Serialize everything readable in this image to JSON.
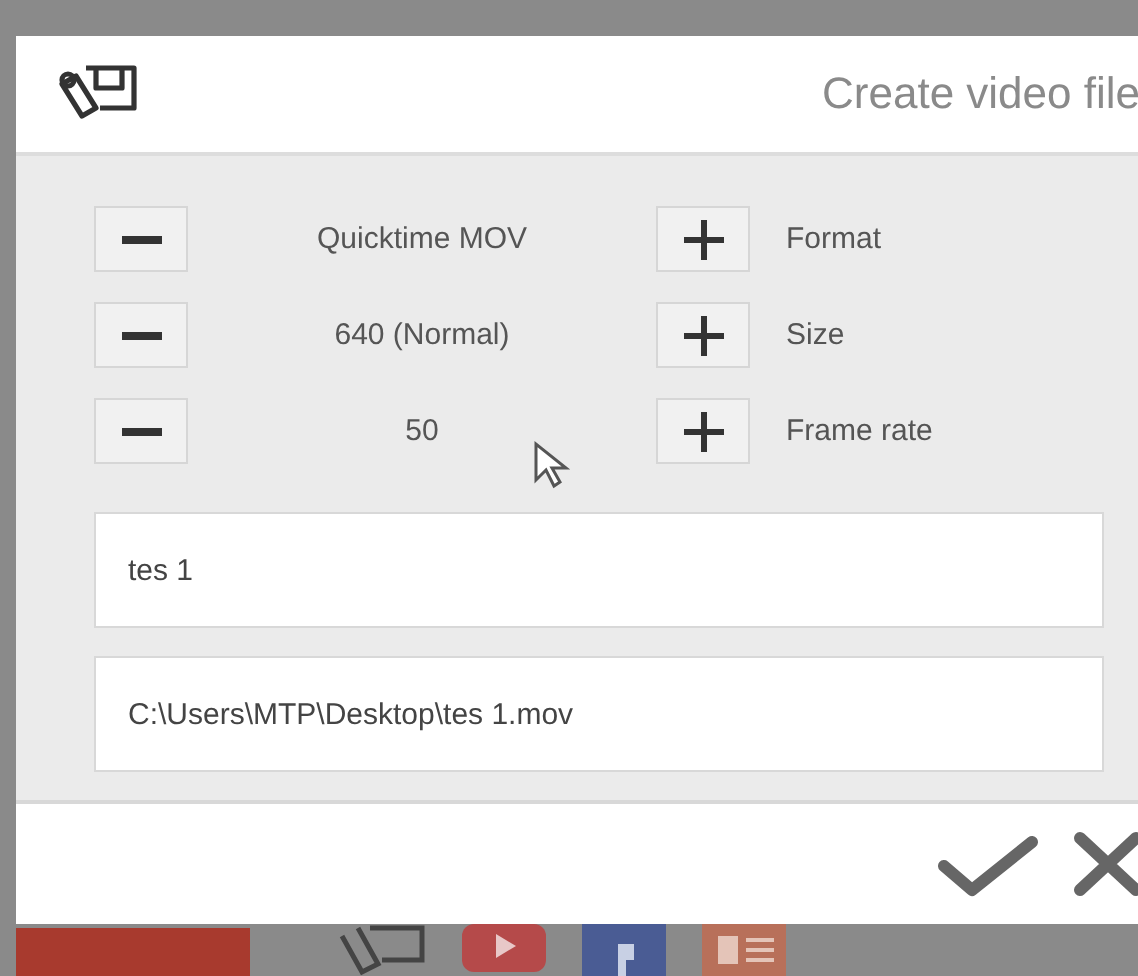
{
  "dialog": {
    "title": "Create video file",
    "settings": [
      {
        "value": "Quicktime MOV",
        "label": "Format"
      },
      {
        "value": "640 (Normal)",
        "label": "Size"
      },
      {
        "value": "50",
        "label": "Frame rate"
      }
    ],
    "name_field": {
      "value": "tes 1"
    },
    "path_field": {
      "value": "C:\\Users\\MTP\\Desktop\\tes 1.mov"
    }
  }
}
